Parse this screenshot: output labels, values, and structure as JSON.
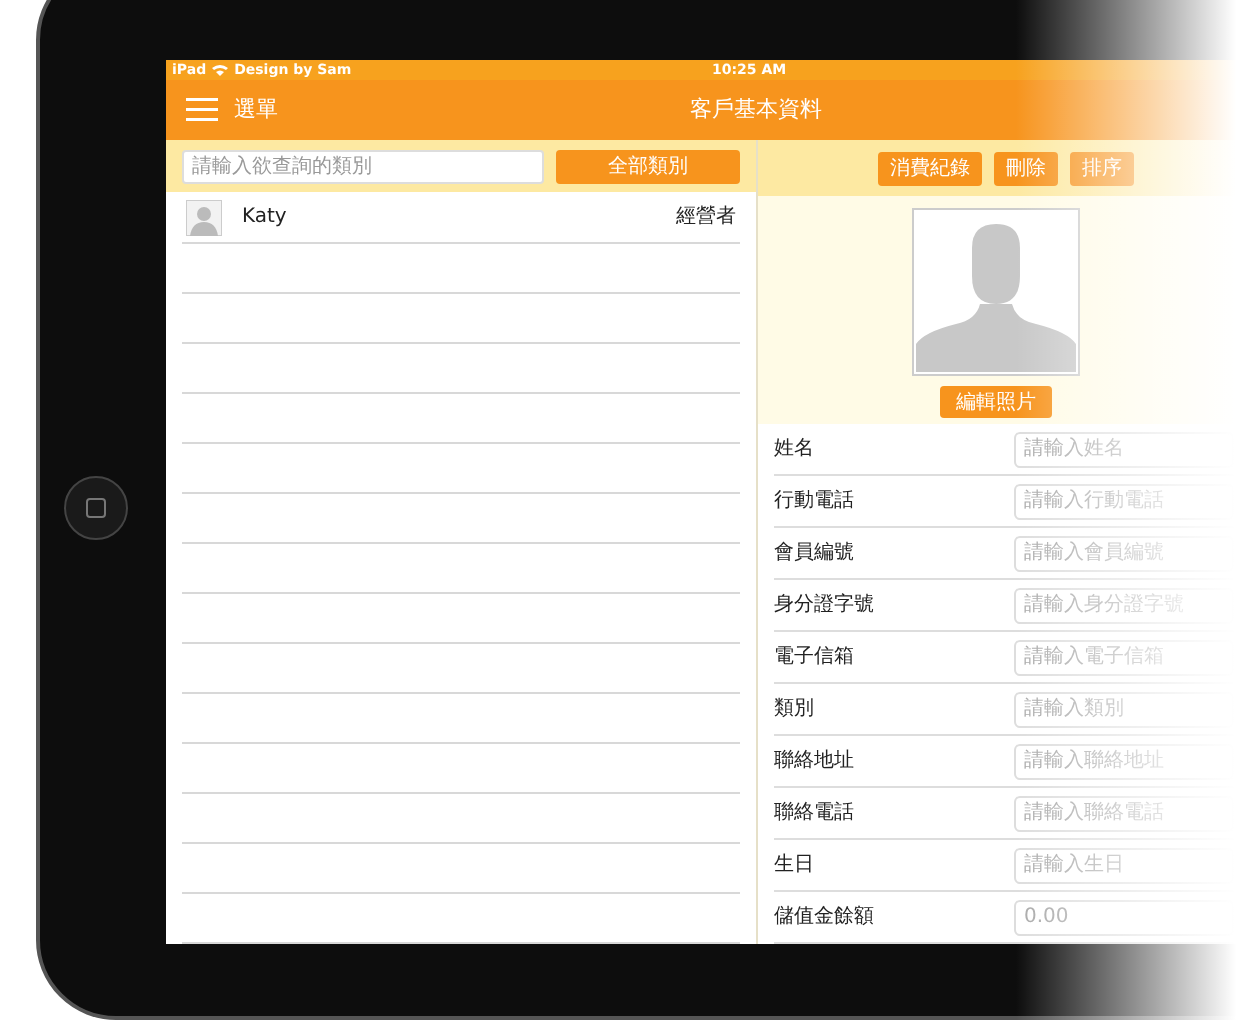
{
  "status_bar": {
    "device": "iPad",
    "network": "Design by Sam",
    "time": "10:25 AM"
  },
  "header": {
    "menu_label": "選單",
    "title": "客戶基本資料"
  },
  "left_panel": {
    "search": {
      "placeholder": "請輸入欲查詢的類別"
    },
    "category_button": "全部類別",
    "contacts": [
      {
        "name": "Katy",
        "role": "經營者"
      }
    ]
  },
  "right_panel": {
    "buttons": [
      "消費紀錄",
      "刪除",
      "排序"
    ],
    "photo_button": "編輯照片",
    "fields": [
      {
        "label": "姓名",
        "placeholder": "請輸入姓名"
      },
      {
        "label": "行動電話",
        "placeholder": "請輸入行動電話"
      },
      {
        "label": "會員編號",
        "placeholder": "請輸入會員編號"
      },
      {
        "label": "身分證字號",
        "placeholder": "請輸入身分證字號"
      },
      {
        "label": "電子信箱",
        "placeholder": "請輸入電子信箱"
      },
      {
        "label": "類別",
        "placeholder": "請輸入類別"
      },
      {
        "label": "聯絡地址",
        "placeholder": "請輸入聯絡地址"
      },
      {
        "label": "聯絡電話",
        "placeholder": "請輸入聯絡電話"
      },
      {
        "label": "生日",
        "placeholder": "請輸入生日"
      },
      {
        "label": "儲值金餘額",
        "placeholder": "0.00"
      }
    ]
  }
}
